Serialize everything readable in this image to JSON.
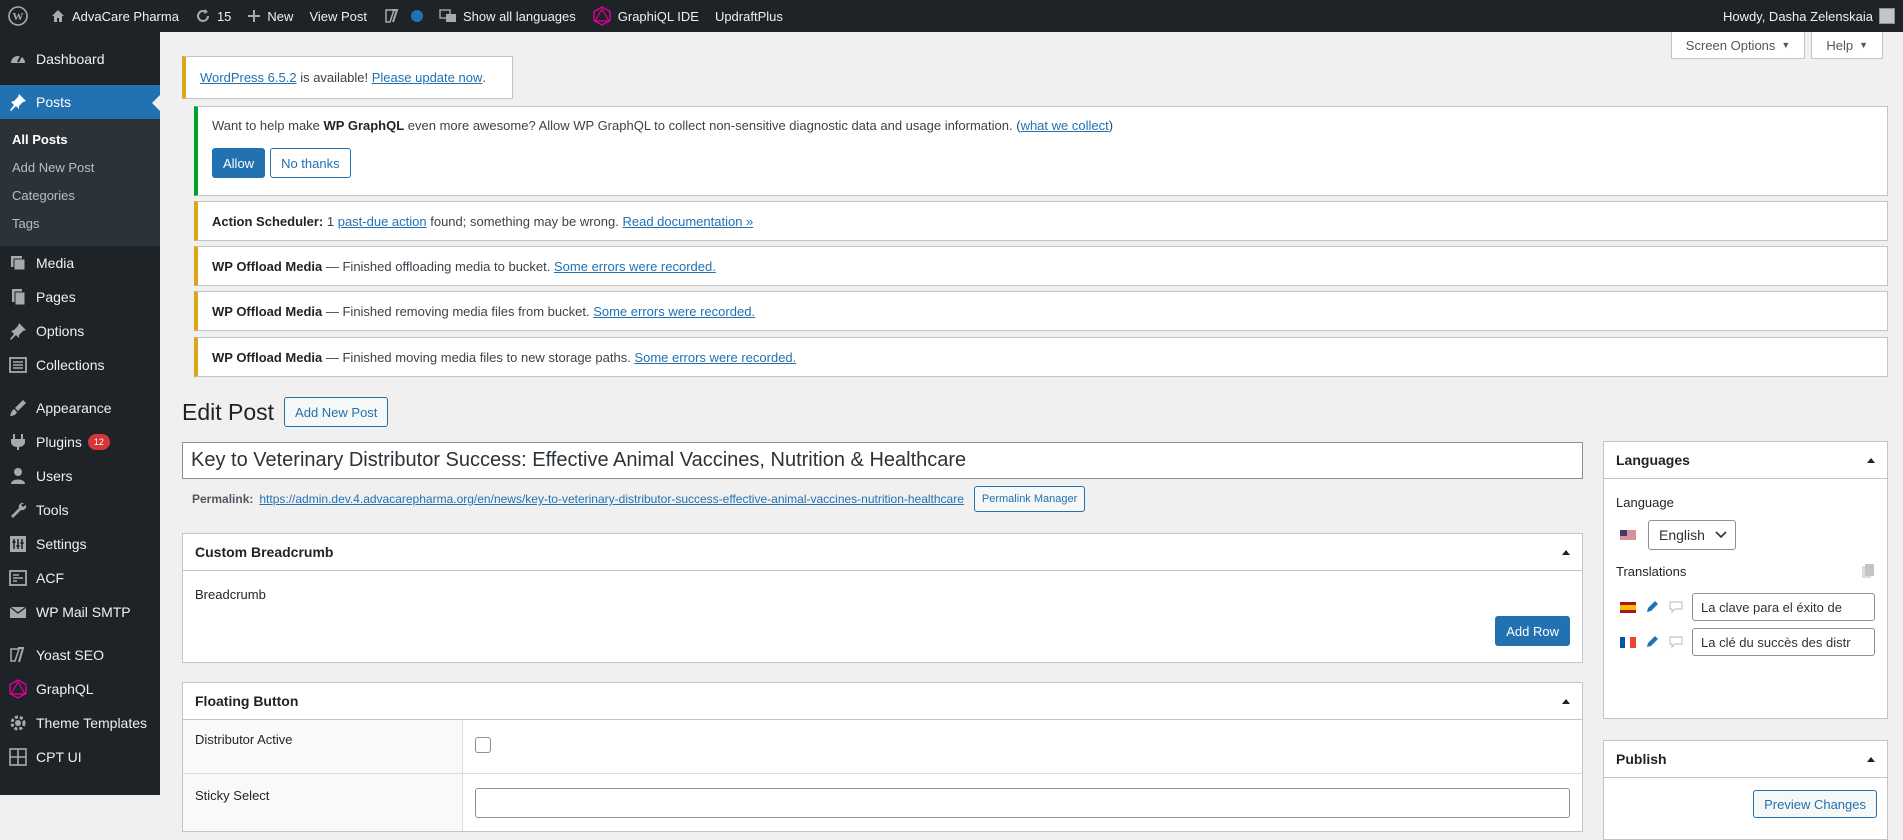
{
  "adminbar": {
    "site_name": "AdvaCare Pharma",
    "updates_count": "15",
    "new_label": "New",
    "view_post": "View Post",
    "languages": "Show all languages",
    "graphiql": "GraphiQL IDE",
    "updraft": "UpdraftPlus",
    "howdy": "Howdy, Dasha Zelenskaia"
  },
  "sidebar": {
    "dashboard": "Dashboard",
    "posts": "Posts",
    "sub_all": "All Posts",
    "sub_add": "Add New Post",
    "sub_categories": "Categories",
    "sub_tags": "Tags",
    "media": "Media",
    "pages": "Pages",
    "options": "Options",
    "collections": "Collections",
    "appearance": "Appearance",
    "plugins": "Plugins",
    "plugins_badge": "12",
    "users": "Users",
    "tools": "Tools",
    "settings": "Settings",
    "acf": "ACF",
    "wpmail": "WP Mail SMTP",
    "yoast": "Yoast SEO",
    "graphql": "GraphQL",
    "theme_templates": "Theme Templates",
    "cptui": "CPT UI"
  },
  "screen": {
    "options": "Screen Options",
    "help": "Help"
  },
  "notices": {
    "update_link": "WordPress 6.5.2",
    "update_mid": " is available! ",
    "update_now": "Please update now",
    "update_end": ".",
    "gql_pre": "Want to help make ",
    "gql_bold": "WP GraphQL",
    "gql_post": " even more awesome? Allow WP GraphQL to collect non-sensitive diagnostic data and usage information. (",
    "gql_link": "what we collect",
    "gql_end": ")",
    "allow": "Allow",
    "no_thanks": "No thanks",
    "as_bold": "Action Scheduler:",
    "as_pre": " 1 ",
    "as_link": "past-due action",
    "as_post": " found; something may be wrong. ",
    "as_doc": "Read documentation »",
    "om_bold": "WP Offload Media",
    "om1_text": " — Finished offloading media to bucket. ",
    "om2_text": " — Finished removing media files from bucket. ",
    "om3_text": " — Finished moving media files to new storage paths. ",
    "om_errors": "Some errors were recorded."
  },
  "edit": {
    "heading": "Edit Post",
    "add_new": "Add New Post",
    "title": "Key to Veterinary Distributor Success: Effective Animal Vaccines, Nutrition & Healthcare",
    "permalink_label": "Permalink:",
    "permalink_url": "https://admin.dev.4.advacarepharma.org/en/news/key-to-veterinary-distributor-success-effective-animal-vaccines-nutrition-healthcare",
    "permalink_manager": "Permalink Manager"
  },
  "breadcrumb_box": {
    "title": "Custom Breadcrumb",
    "field_label": "Breadcrumb",
    "add_row": "Add Row"
  },
  "floating_box": {
    "title": "Floating Button",
    "distributor_label": "Distributor Active",
    "sticky_label": "Sticky Select"
  },
  "languages_box": {
    "title": "Languages",
    "language_label": "Language",
    "selected": "English",
    "translations_label": "Translations",
    "es_value": "La clave para el éxito de",
    "fr_value": "La clé du succès des distr"
  },
  "publish_box": {
    "title": "Publish",
    "preview": "Preview Changes"
  }
}
